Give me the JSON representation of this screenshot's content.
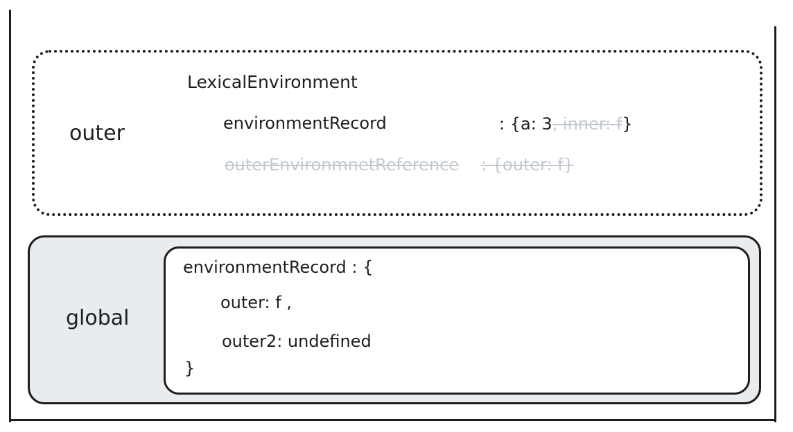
{
  "outer": {
    "context_label": "outer",
    "lexical_environment_title": "LexicalEnvironment",
    "environment_record_label": "environmentRecord",
    "environment_record_prefix": ": {a: 3",
    "environment_record_removed": ", inner: f",
    "environment_record_suffix": "}",
    "outer_reference_label": "outerEnvironmnetReference",
    "outer_reference_value": ": {outer: f}"
  },
  "global": {
    "context_label": "global",
    "record_open": "environmentRecord : {",
    "entry_outer": "outer: f ,",
    "entry_outer2": "outer2: undefined",
    "record_close": "}"
  },
  "colors": {
    "ink": "#1e1e1e",
    "faded": "#c3c9cf",
    "global_fill": "#e9ecef"
  }
}
